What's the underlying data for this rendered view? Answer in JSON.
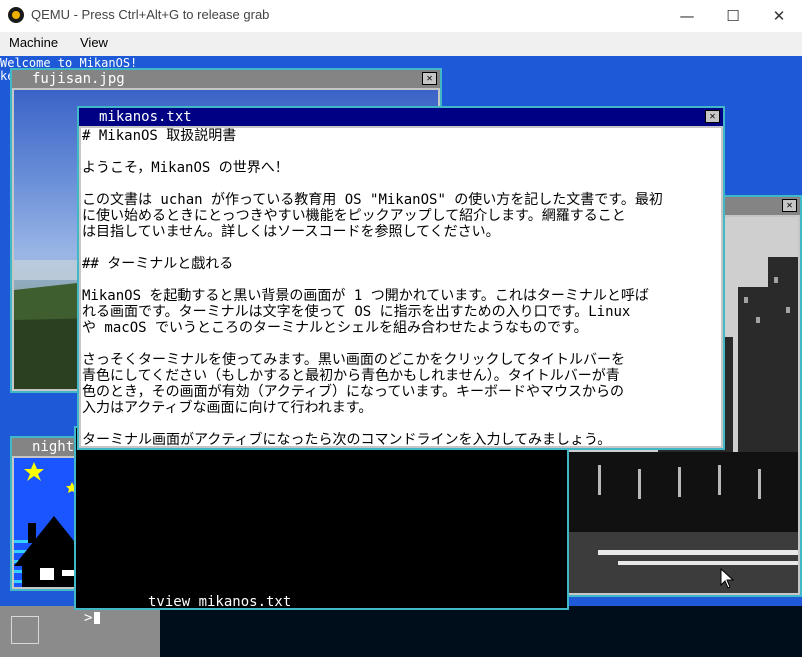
{
  "host": {
    "title": "QEMU - Press Ctrl+Alt+G to release grab",
    "menu": [
      "Machine",
      "View"
    ],
    "controls": [
      "—",
      "☐",
      "✕"
    ]
  },
  "console": {
    "lines": [
      "Welcome to MikanOS!",
      "ke"
    ]
  },
  "windows": {
    "fujisan": {
      "title": "fujisan.jpg"
    },
    "night": {
      "title": "night.bmp"
    },
    "mikanos": {
      "title": "mikanos.txt",
      "lines": [
        "# MikanOS 取扱説明書",
        "",
        "ようこそ，MikanOS の世界へ！",
        "",
        "この文書は uchan が作っている教育用 OS \"MikanOS\" の使い方を記した文書です。最初",
        "に使い始めるときにとっつきやすい機能をピックアップして紹介します。網羅すること",
        "は目指していません。詳しくはソースコードを参照してください。",
        "",
        "## ターミナルと戯れる",
        "",
        "MikanOS を起動すると黒い背景の画面が 1 つ開かれています。これはターミナルと呼ば",
        "れる画面です。ターミナルは文字を使って OS に指示を出すための入り口です。Linux",
        "や macOS でいうところのターミナルとシェルを組み合わせたようなものです。",
        "",
        "さっそくターミナルを使ってみます。黒い画面のどこかをクリックしてタイトルバーを",
        "青色にしてください（もしかすると最初から青色かもしれません）。タイトルバーが青",
        "色のとき，その画面が有効（アクティブ）になっています。キーボードやマウスからの",
        "入力はアクティブな画面に向けて行われます。",
        "",
        "ターミナル画面がアクティブになったら次のコマンドラインを入力してみましょう。"
      ]
    },
    "terminal": {
      "command": "tview mikanos.txt",
      "prompt": ">"
    }
  }
}
